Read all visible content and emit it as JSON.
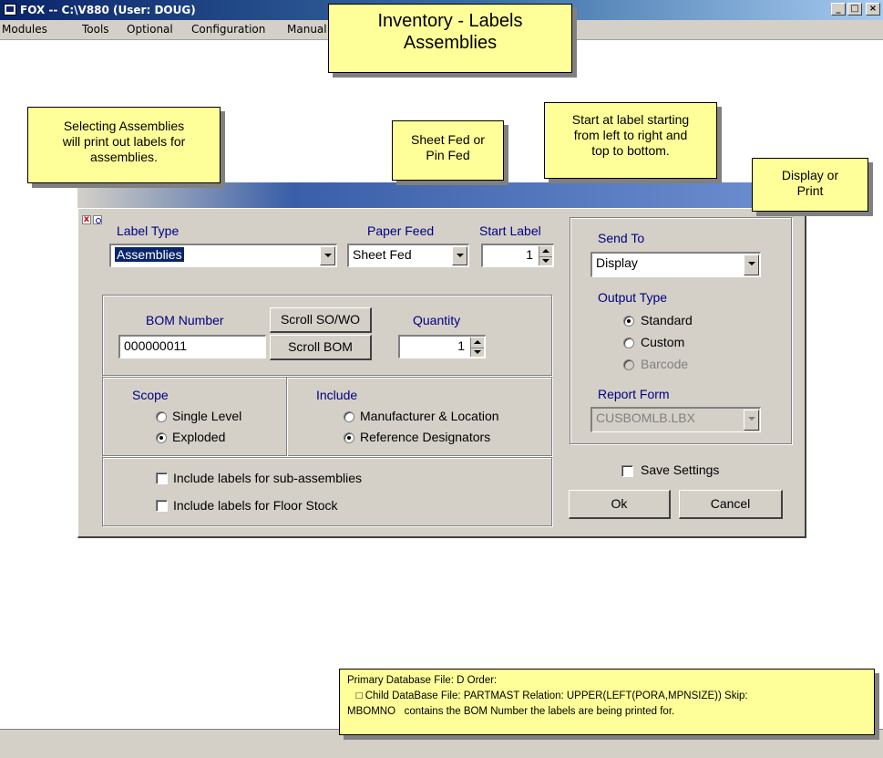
{
  "window": {
    "title": "FOX -- C:\\V880  (User: DOUG)",
    "controls": [
      "_",
      "□",
      "×"
    ]
  },
  "menu": [
    "Modules",
    "Tools",
    "Optional",
    "Configuration",
    "Manual"
  ],
  "callouts": {
    "title_line1": "Inventory - Labels",
    "title_line2": "Assemblies",
    "assemblies": [
      "Selecting Assemblies",
      "will print out labels for",
      "assemblies."
    ],
    "sheet_fed": [
      "Sheet Fed or",
      "Pin Fed"
    ],
    "start_label": [
      "Start at label starting",
      "from left to right and",
      "top to bottom."
    ],
    "display_print": [
      "Display or",
      "Print"
    ],
    "note": [
      "Primary Database File: D Order:",
      "   □ Child DataBase File: PARTMAST Relation: UPPER(LEFT(PORA,MPNSIZE)) Skip:",
      "MBOMNO   contains the BOM Number the labels are being printed for."
    ]
  },
  "dialog": {
    "label_type": {
      "label": "Label Type",
      "value": "Assemblies"
    },
    "paper_feed": {
      "label": "Paper Feed",
      "value": "Sheet Fed"
    },
    "start_label": {
      "label": "Start Label",
      "value": "1"
    },
    "bom_number": {
      "label": "BOM Number",
      "value": "000000011"
    },
    "scroll_sowo": "Scroll SO/WO",
    "scroll_bom": "Scroll BOM",
    "quantity": {
      "label": "Quantity",
      "value": "1"
    },
    "scope": {
      "label": "Scope",
      "options": [
        "Single Level",
        "Exploded"
      ],
      "selected": "Exploded"
    },
    "include": {
      "label": "Include",
      "options": [
        "Manufacturer & Location",
        "Reference Designators"
      ],
      "selected": "Reference Designators"
    },
    "checkboxes": [
      "Include labels for sub-assemblies",
      "Include labels for Floor Stock"
    ],
    "send_to": {
      "label": "Send To",
      "value": "Display"
    },
    "output_type": {
      "label": "Output Type",
      "options": [
        "Standard",
        "Custom",
        "Barcode"
      ],
      "selected": "Standard"
    },
    "report_form": {
      "label": "Report Form",
      "value": "CUSBOMLB.LBX"
    },
    "save_settings": "Save Settings",
    "ok": "Ok",
    "cancel": "Cancel"
  },
  "colors": {
    "titlebar": "#0a246a",
    "face": "#d4d0c8",
    "callout": "#ffff99",
    "label_blue": "#000080",
    "selection": "#0a246a"
  }
}
